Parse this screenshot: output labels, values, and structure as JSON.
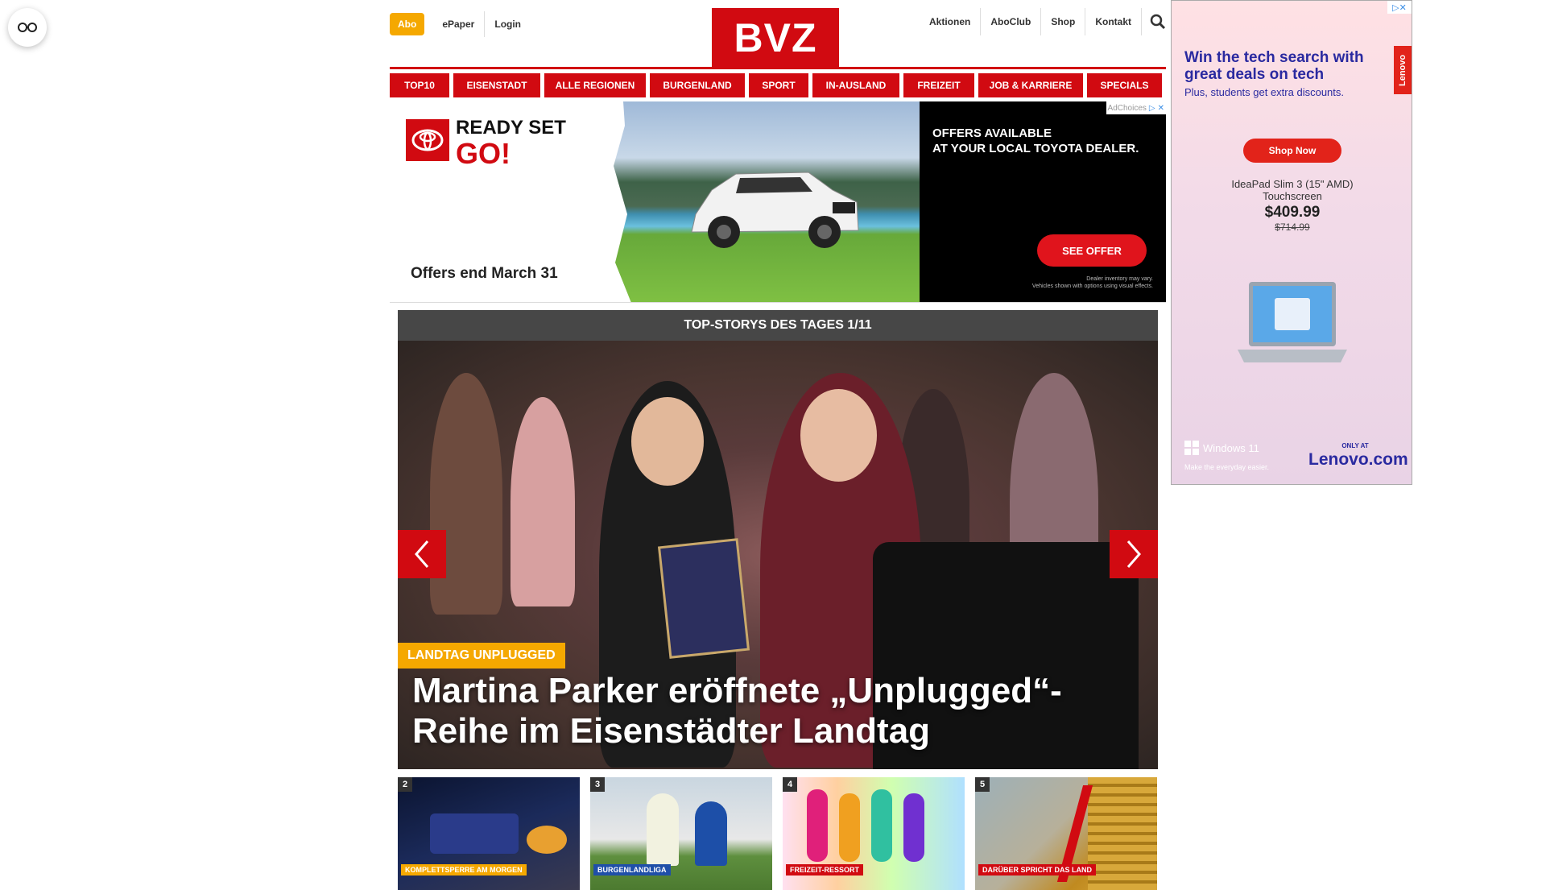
{
  "floating": {
    "icon": "glasses-icon"
  },
  "header": {
    "abo": "Abo",
    "left_links": [
      "ePaper",
      "Login"
    ],
    "logo": "BVZ",
    "right_links": [
      "Aktionen",
      "AboClub",
      "Shop",
      "Kontakt"
    ],
    "search_icon": "search-icon"
  },
  "nav": [
    "TOP10",
    "EISENSTADT",
    "ALLE REGIONEN",
    "BURGENLAND",
    "SPORT",
    "IN-AUSLAND",
    "FREIZEIT",
    "JOB & KARRIERE",
    "SPECIALS"
  ],
  "ad_banner": {
    "headline_1": "READY SET",
    "headline_2": "GO!",
    "offers_end": "Offers end March 31",
    "offers_available_1": "OFFERS AVAILABLE",
    "offers_available_2": "AT YOUR LOCAL TOYOTA DEALER.",
    "cta": "SEE OFFER",
    "disclaimer_1": "Dealer inventory may vary.",
    "disclaimer_2": "Vehicles shown with options using visual effects.",
    "adchoices": "AdChoices"
  },
  "stories": {
    "header": "TOP-STORYS DES TAGES 1/11",
    "kicker": "LANDTAG UNPLUGGED",
    "headline": "Martina Parker eröffnete „Unplugged“-Reihe im Eisenstädter Landtag",
    "thumbs": [
      {
        "num": "2",
        "tag": "KOMPLETTSPERRE AM MORGEN",
        "color": "#f5a800"
      },
      {
        "num": "3",
        "tag": "BURGENLANDLIGA",
        "color": "#1f4fa8"
      },
      {
        "num": "4",
        "tag": "FREIZEIT-RESSORT",
        "color": "#d10a11"
      },
      {
        "num": "5",
        "tag": "DARÜBER SPRICHT DAS LAND",
        "color": "#d10a11"
      }
    ]
  },
  "side_ad": {
    "title": "Win the tech search with great deals on tech",
    "sub": "Plus, students get extra discounts.",
    "cta": "Shop Now",
    "product_1": "IdeaPad Slim 3 (15\" AMD)",
    "product_2": "Touchscreen",
    "price": "$409.99",
    "old_price": "$714.99",
    "windows": "Windows 11",
    "windows_sub": "Make the everyday easier.",
    "only_at": "ONLY AT",
    "lenovo_com": "Lenovo.com",
    "brand_tab": "Lenovo"
  }
}
